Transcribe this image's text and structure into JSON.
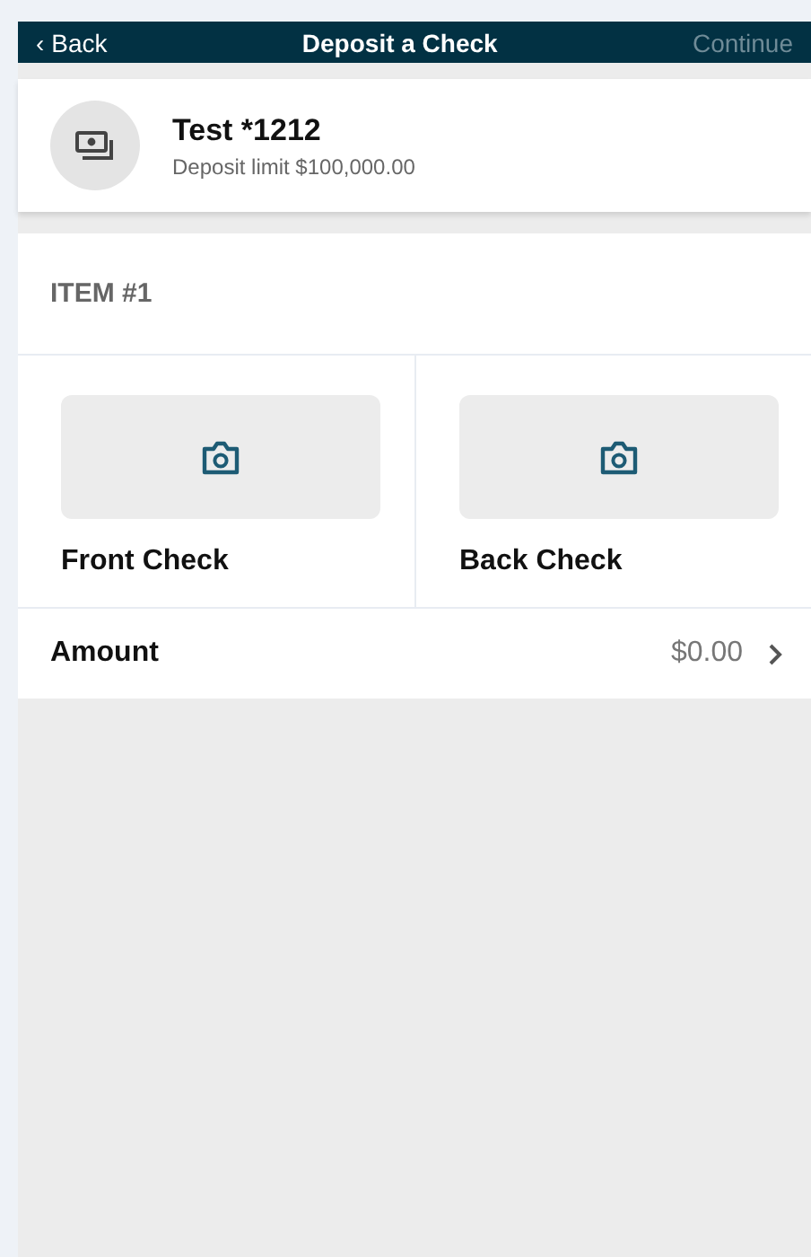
{
  "header": {
    "back": {
      "icon": "‹",
      "label": "Back"
    },
    "title": "Deposit a Check",
    "continue": {
      "label": "Continue",
      "disabled": true
    }
  },
  "account": {
    "name": "Test *1212",
    "limit": "Deposit limit $100,000.00"
  },
  "item": {
    "title": "ITEM #1",
    "captures": [
      {
        "label": "Front Check"
      },
      {
        "label": "Back Check"
      }
    ]
  },
  "amount": {
    "label": "Amount",
    "value": "$0.00"
  }
}
